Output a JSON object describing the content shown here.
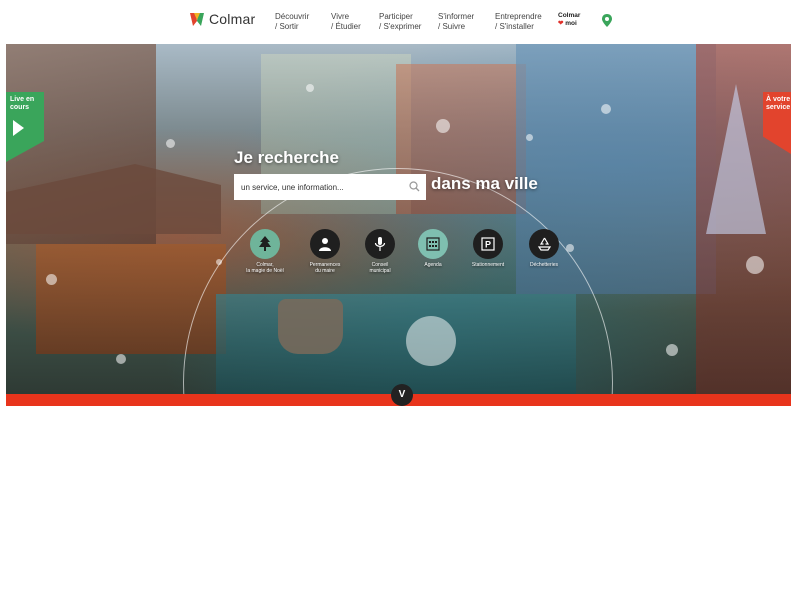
{
  "header": {
    "logo_text": "Colmar",
    "nav": [
      {
        "line1": "Découvrir",
        "line2": "/ Sortir"
      },
      {
        "line1": "Vivre",
        "line2": "/ Étudier"
      },
      {
        "line1": "Participer",
        "line2": "/ S'exprimer"
      },
      {
        "line1": "S'informer",
        "line2": "/ Suivre"
      },
      {
        "line1": "Entreprendre",
        "line2": "/ S'installer"
      }
    ],
    "colmar_moi": {
      "line1": "Colmar",
      "heart": "❤",
      "line2": "moi"
    },
    "icons": {
      "logo": "colmar-logo-icon",
      "map_pin": "map-pin-icon"
    },
    "colors": {
      "brand_red": "#e2442d",
      "brand_green": "#3aa55b"
    }
  },
  "hero": {
    "headline": "Je recherche",
    "search_placeholder": "un service, une information...",
    "headline_suffix": "dans ma ville",
    "live_badge": {
      "line1": "Live en",
      "line2": "cours"
    },
    "right_badge": {
      "line1": "À votre",
      "line2": "service"
    },
    "quick_links": [
      {
        "label1": "Colmar,",
        "label2": "la magie de Noël",
        "icon": "tree-icon",
        "color": "#6fb49a"
      },
      {
        "label1": "Permanences",
        "label2": "du maire",
        "icon": "person-icon",
        "color": "#1f1f1f"
      },
      {
        "label1": "Conseil",
        "label2": "municipal",
        "icon": "microphone-icon",
        "color": "#1f1f1f"
      },
      {
        "label1": "Agenda",
        "label2": "",
        "icon": "calendar-icon",
        "color": "#7fbfb0"
      },
      {
        "label1": "Stationnement",
        "label2": "",
        "icon": "parking-icon",
        "color": "#1f1f1f"
      },
      {
        "label1": "Déchetteries",
        "label2": "",
        "icon": "recycle-icon",
        "color": "#1f1f1f"
      }
    ],
    "scroll_label": "V"
  }
}
